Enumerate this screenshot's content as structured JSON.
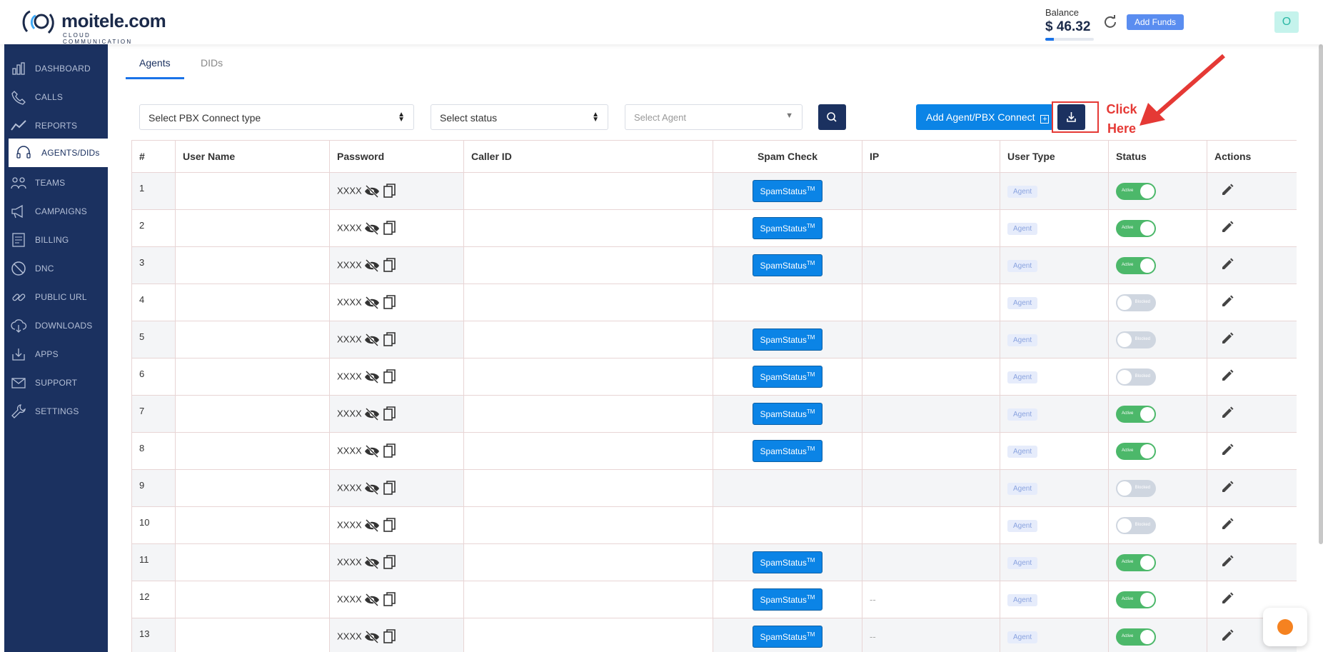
{
  "brand": {
    "name": "moitele.com",
    "tagline": "CLOUD COMMUNICATION"
  },
  "header": {
    "balance_label": "Balance",
    "balance_amount": "$ 46.32",
    "balance_fill_percent": 18,
    "add_funds_label": "Add Funds",
    "avatar_initial": "O"
  },
  "sidebar": {
    "items": [
      {
        "label": "DASHBOARD",
        "icon": "dashboard-icon"
      },
      {
        "label": "CALLS",
        "icon": "calls-icon"
      },
      {
        "label": "REPORTS",
        "icon": "reports-icon"
      },
      {
        "label": "AGENTS/DIDs",
        "icon": "headset-icon",
        "active": true
      },
      {
        "label": "TEAMS",
        "icon": "teams-icon"
      },
      {
        "label": "CAMPAIGNS",
        "icon": "megaphone-icon"
      },
      {
        "label": "BILLING",
        "icon": "billing-icon"
      },
      {
        "label": "DNC",
        "icon": "dnc-icon"
      },
      {
        "label": "PUBLIC URL",
        "icon": "link-icon"
      },
      {
        "label": "DOWNLOADS",
        "icon": "cloud-download-icon"
      },
      {
        "label": "APPS",
        "icon": "apps-icon"
      },
      {
        "label": "SUPPORT",
        "icon": "mail-icon"
      },
      {
        "label": "SETTINGS",
        "icon": "wrench-icon"
      }
    ]
  },
  "tabs": [
    {
      "label": "Agents",
      "active": true
    },
    {
      "label": "DIDs",
      "active": false
    }
  ],
  "filters": {
    "pbx_type": "Select PBX Connect type",
    "status": "Select status",
    "agent": "Select Agent"
  },
  "toolbar": {
    "add_agent_label": "Add Agent/PBX Connect",
    "plus": "+"
  },
  "annotation": {
    "line1": "Click",
    "line2": "Here"
  },
  "table": {
    "columns": [
      "#",
      "User Name",
      "Password",
      "Caller ID",
      "Spam Check",
      "IP",
      "User Type",
      "Status",
      "Actions"
    ],
    "rows": [
      {
        "num": "1",
        "password": "XXXX",
        "spam": "SpamStatus",
        "ip": "",
        "user_type": "Agent",
        "status": "Active",
        "active": true
      },
      {
        "num": "2",
        "password": "XXXX",
        "spam": "SpamStatus",
        "ip": "",
        "user_type": "Agent",
        "status": "Active",
        "active": true
      },
      {
        "num": "3",
        "password": "XXXX",
        "spam": "SpamStatus",
        "ip": "",
        "user_type": "Agent",
        "status": "Active",
        "active": true
      },
      {
        "num": "4",
        "password": "XXXX",
        "spam": "",
        "ip": "",
        "user_type": "Agent",
        "status": "Blocked",
        "active": false
      },
      {
        "num": "5",
        "password": "XXXX",
        "spam": "SpamStatus",
        "ip": "",
        "user_type": "Agent",
        "status": "Blocked",
        "active": false
      },
      {
        "num": "6",
        "password": "XXXX",
        "spam": "SpamStatus",
        "ip": "",
        "user_type": "Agent",
        "status": "Blocked",
        "active": false
      },
      {
        "num": "7",
        "password": "XXXX",
        "spam": "SpamStatus",
        "ip": "",
        "user_type": "Agent",
        "status": "Active",
        "active": true
      },
      {
        "num": "8",
        "password": "XXXX",
        "spam": "SpamStatus",
        "ip": "",
        "user_type": "Agent",
        "status": "Active",
        "active": true
      },
      {
        "num": "9",
        "password": "XXXX",
        "spam": "",
        "ip": "",
        "user_type": "Agent",
        "status": "Blocked",
        "active": false
      },
      {
        "num": "10",
        "password": "XXXX",
        "spam": "",
        "ip": "",
        "user_type": "Agent",
        "status": "Blocked",
        "active": false
      },
      {
        "num": "11",
        "password": "XXXX",
        "spam": "SpamStatus",
        "ip": "",
        "user_type": "Agent",
        "status": "Active",
        "active": true
      },
      {
        "num": "12",
        "password": "XXXX",
        "spam": "SpamStatus",
        "ip": "--",
        "user_type": "Agent",
        "status": "Active",
        "active": true
      },
      {
        "num": "13",
        "password": "XXXX",
        "spam": "SpamStatus",
        "ip": "--",
        "user_type": "Agent",
        "status": "Active",
        "active": true
      }
    ]
  },
  "colors": {
    "sidebar": "#1b3160",
    "accent": "#0b84e6",
    "active_toggle": "#4cb86a",
    "annotation": "#e53935"
  }
}
